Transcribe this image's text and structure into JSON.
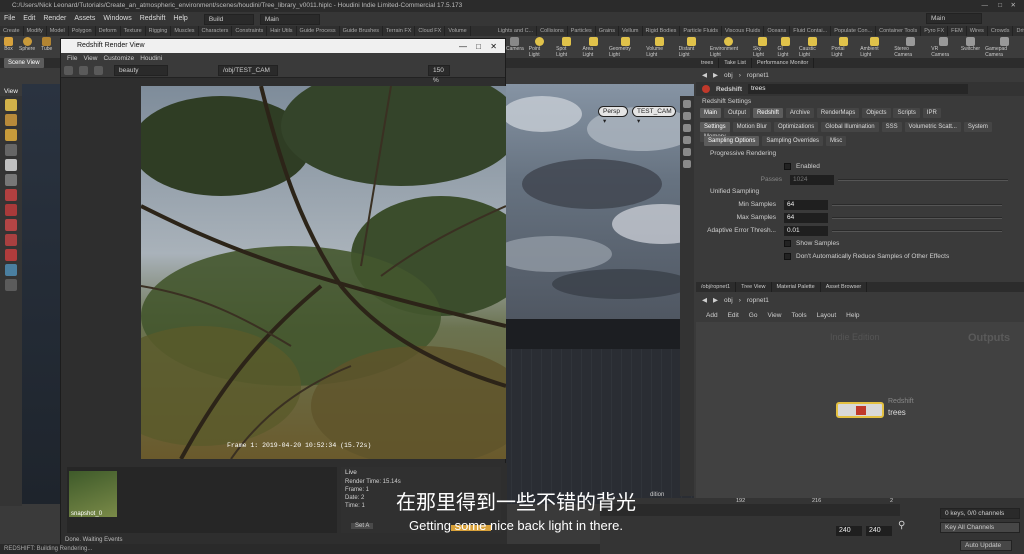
{
  "window_title": "C:/Users/Nick Leonard/Tutorials/Create_an_atmospheric_environment/scenes/houdini/Tree_library_v0011.hiplc - Houdini Indie Limited-Commercial 17.5.173",
  "menu": [
    "File",
    "Edit",
    "Render",
    "Assets",
    "Windows",
    "Redshift",
    "Help"
  ],
  "desktop_build": "Build",
  "desktop_main": "Main",
  "main_right": "Main",
  "shelf_tabs_left": [
    "Create",
    "Modify",
    "Model",
    "Polygon",
    "Deform",
    "Texture",
    "Rigging",
    "Muscles",
    "Characters",
    "Constraints",
    "Hair Utils",
    "Guide Process",
    "Guide Brushes",
    "Terrain FX",
    "Cloud FX",
    "Volume"
  ],
  "shelf_tabs_right": [
    "Lights and C...",
    "Collisions",
    "Particles",
    "Grains",
    "Vellum",
    "Rigid Bodies",
    "Particle Fluids",
    "Viscous Fluids",
    "Oceans",
    "Fluid Contai...",
    "Populate Con...",
    "Container Tools",
    "Pyro FX",
    "FEM",
    "Wires",
    "Crowds",
    "Drive Simula..."
  ],
  "shelf_tools_left": [
    "Box",
    "Sphere",
    "Tube"
  ],
  "shelf_tools_right": [
    "Camera",
    "Point Light",
    "Spot Light",
    "Area Light",
    "Geometry Light",
    "Volume Light",
    "Distant Light",
    "Environment Light",
    "Sky Light",
    "GI Light",
    "Caustic Light",
    "Portal Light",
    "Ambient Light",
    "Stereo Camera",
    "VR Camera",
    "Switcher",
    "Gamepad Camera"
  ],
  "render_view": {
    "title": "Redshift Render View",
    "menu": [
      "File",
      "View",
      "Customize",
      "Houdini"
    ],
    "aov": "beauty",
    "camera": "/obj/TEST_CAM",
    "zoom": "150 %",
    "frame_info": "Frame 1: 2019-04-20  10:52:34  (15.72s)",
    "snapshot_label": "snapshot_0",
    "live_label": "Live",
    "stats": [
      "Render Time: 15.14s",
      "Frame: 1",
      "Date: 2",
      "Time: 1"
    ],
    "set_button": "Set A",
    "status": "Done. Waiting Events"
  },
  "viewport": {
    "scene_view": "Scene View",
    "view_label": "View",
    "persp": "Persp ▾",
    "camera": "TEST_CAM ▾",
    "edition": "dition"
  },
  "status_bar": "REDSHIFT: Building Rendering...",
  "right_panel": {
    "tabs": [
      "trees",
      "Take List",
      "Performance Monitor"
    ],
    "path": [
      "obj",
      "ropnet1"
    ],
    "node_type": "Redshift",
    "node_name": "trees",
    "settings_header": "Redshift Settings",
    "main_tabs": [
      "Main",
      "Output",
      "Redshift",
      "Archive",
      "RenderMaps",
      "Objects",
      "Scripts",
      "IPR"
    ],
    "sub_tabs": [
      "Settings",
      "Motion Blur",
      "Optimizations",
      "Global Illumination",
      "SSS",
      "Volumetric Scatt...",
      "System",
      "Memory"
    ],
    "sub_sub_tabs": [
      "Sampling Options",
      "Sampling Overrides",
      "Misc"
    ],
    "progressive_rendering": "Progressive Rendering",
    "enabled_label": "Enabled",
    "passes_label": "Passes",
    "passes_value": "1024",
    "unified_sampling": "Unified Sampling",
    "params": [
      {
        "label": "Min Samples",
        "value": "64"
      },
      {
        "label": "Max Samples",
        "value": "64"
      },
      {
        "label": "Adaptive Error Thresh...",
        "value": "0.01"
      }
    ],
    "show_samples": "Show Samples",
    "dont_reduce": "Don't Automatically Reduce Samples of Other Effects"
  },
  "network": {
    "tabs": [
      "/obj/ropnet1",
      "Tree View",
      "Material Palette",
      "Asset Browser"
    ],
    "path": [
      "obj",
      "ropnet1"
    ],
    "menu": [
      "Add",
      "Edit",
      "Go",
      "View",
      "Tools",
      "Layout",
      "Help"
    ],
    "watermark": "Indie Edition",
    "context": "Outputs",
    "node_type": "Redshift",
    "node_name": "trees"
  },
  "timeline": {
    "ticks": [
      "192",
      "216",
      "2"
    ],
    "end_a": "240",
    "end_b": "240",
    "keys": "0 keys, 0/0 channels",
    "key_all": "Key All Channels",
    "auto_update": "Auto Update"
  },
  "subtitles": {
    "zh": "在那里得到一些不错的背光",
    "en": "Getting some nice back light in there."
  }
}
